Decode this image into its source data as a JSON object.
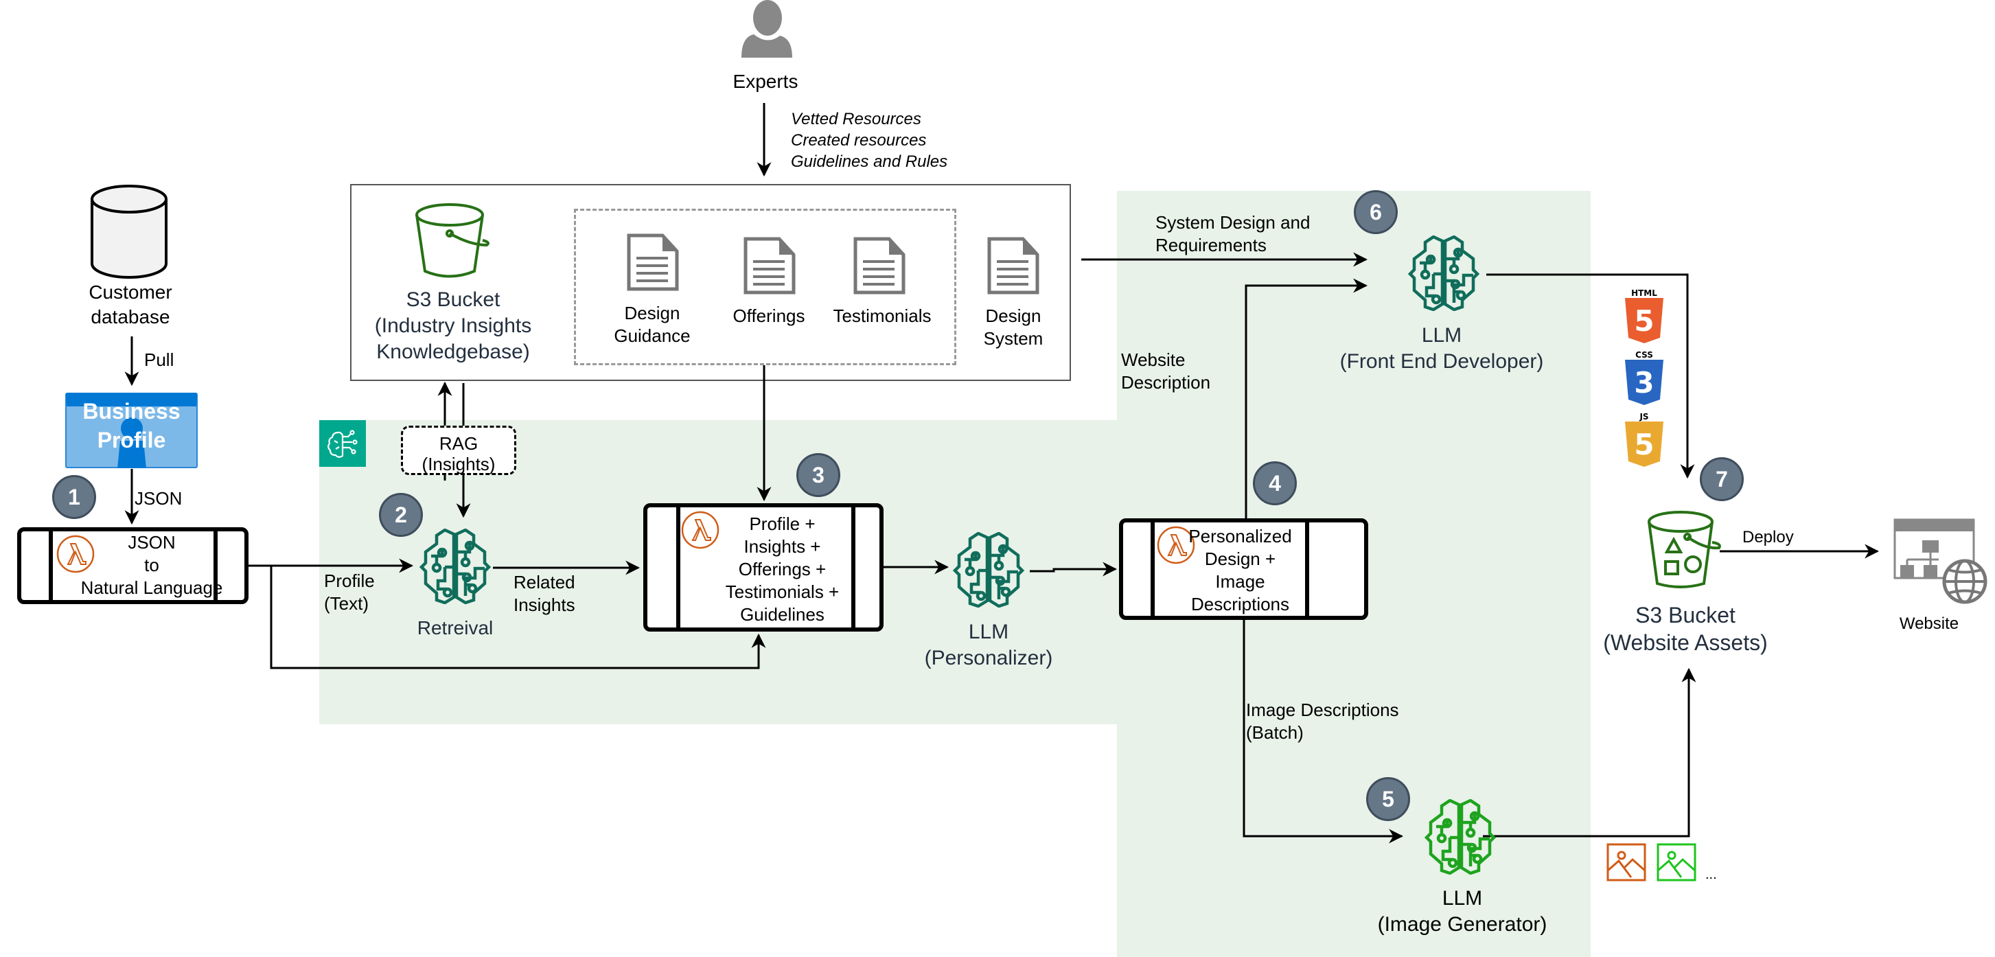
{
  "diagram": {
    "colors": {
      "region_bg": "#e8f2e9",
      "badge_fill": "#667788",
      "lambda_orange": "#d05c17",
      "ai_teal": "#116d5b",
      "s3_green": "#277116",
      "image_gen_green": "#1fa31f",
      "business_profile_blue": "#0078d4"
    },
    "experts": {
      "label": "Experts",
      "arrow_notes": [
        "Vetted Resources",
        "Created resources",
        "Guidelines and Rules"
      ]
    },
    "customer_db": {
      "label": "Customer\ndatabase",
      "arrow_label": "Pull"
    },
    "business_profile": {
      "label": "Business\nProfile",
      "arrow_label": "JSON"
    },
    "resources": {
      "s3_bucket": {
        "label": "S3 Bucket\n(Industry Insights\nKnowledgebase)"
      },
      "docs": [
        {
          "label": "Design\nGuidance"
        },
        {
          "label": "Offerings"
        },
        {
          "label": "Testimonials"
        }
      ],
      "design_system": {
        "label": "Design\nSystem"
      }
    },
    "rag": {
      "label": "RAG\n(Insights)"
    },
    "steps": [
      {
        "number": "1",
        "label": "JSON\nto\nNatural Language"
      },
      {
        "number": "2",
        "label": "Retreival"
      },
      {
        "number": "3",
        "label": "Profile +\nInsights +\nOfferings +\nTestimonials +\nGuidelines"
      },
      {
        "number": "4",
        "label": "Personalized\nDesign +\nImage\nDescriptions"
      },
      {
        "number": "5",
        "label": "LLM\n(Image Generator)"
      },
      {
        "number": "6",
        "label": "LLM\n(Front End Developer)"
      },
      {
        "number": "7",
        "label": "S3 Bucket\n(Website Assets)"
      }
    ],
    "personalizer": {
      "label": "LLM\n(Personalizer)"
    },
    "edge_labels": {
      "profile_text": "Profile\n(Text)",
      "related_insights": "Related\nInsights",
      "system_design": "System Design and\nRequirements",
      "website_description": "Website\nDescription",
      "image_descriptions": "Image Descriptions\n(Batch)",
      "deploy": "Deploy"
    },
    "assets": {
      "html_label": "HTML",
      "css_label": "CSS",
      "js_label": "JS",
      "shield_digit_html": "5",
      "shield_digit_css": "3",
      "shield_digit_js": "5",
      "images_more": "..."
    },
    "website": {
      "label": "Website"
    }
  }
}
